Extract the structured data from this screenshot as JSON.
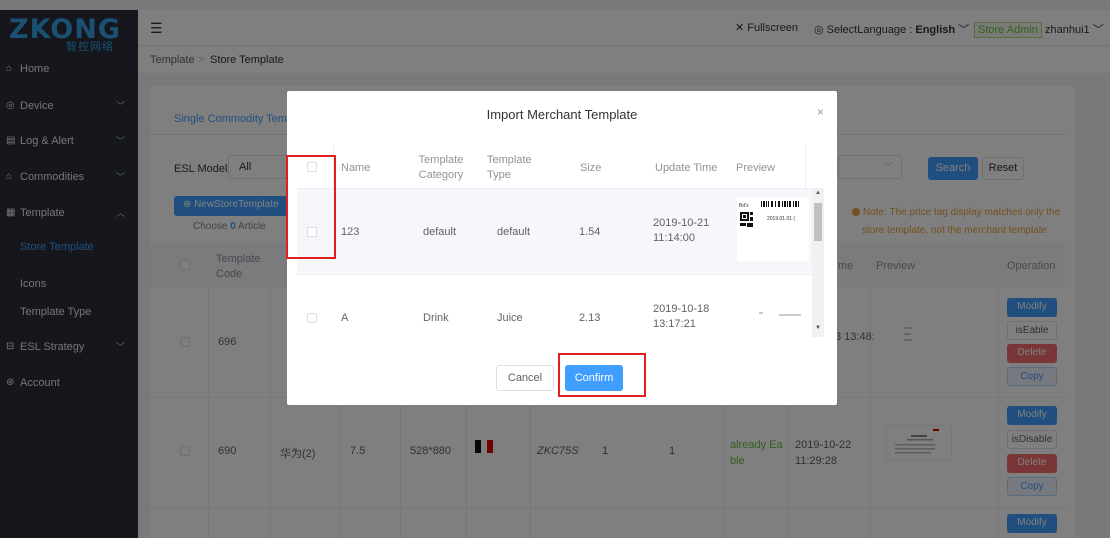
{
  "app": {
    "brand": "ZKONG",
    "brand_cn": "智控网络"
  },
  "header": {
    "fullscreen": "Fullscreen",
    "select_language_prefix": "SelectLanguage :",
    "language": "English",
    "role": "Store Admin",
    "user": "zhanhui1"
  },
  "breadcrumb": {
    "root": "Template",
    "separator": ">",
    "current": "Store Template"
  },
  "sidebar": {
    "items": [
      {
        "label": "Home",
        "icon": "home-icon"
      },
      {
        "label": "Device",
        "icon": "device-icon"
      },
      {
        "label": "Log & Alert",
        "icon": "log-icon"
      },
      {
        "label": "Commodities",
        "icon": "commodities-icon"
      },
      {
        "label": "Template",
        "icon": "template-icon"
      }
    ],
    "sub_items": [
      "Store Template",
      "Icons",
      "Template Type"
    ],
    "after_items": [
      {
        "label": "ESL Strategy",
        "icon": "strategy-icon"
      },
      {
        "label": "Account",
        "icon": "account-icon"
      }
    ]
  },
  "page": {
    "tab_single": "Single Commodity Templa",
    "esl_model_label": "ESL Model",
    "esl_model_value": "All",
    "search_btn": "Search",
    "reset_btn": "Reset",
    "new_store_btn": "NewStoreTemplate",
    "choose_prefix": "Choose",
    "choose_count": "0",
    "choose_suffix": "Article",
    "note_line1": "Note: The price tag display matches only the",
    "note_line2": "store template, not the merchant template",
    "columns": {
      "template_code": "Template Code",
      "time": "me",
      "preview": "Preview",
      "operation": "Operation"
    },
    "rows": [
      {
        "code": "696",
        "time": "3 13:48:",
        "ops": [
          "Modify",
          "isEable",
          "Delete",
          "Copy"
        ]
      },
      {
        "code": "690",
        "name": "华为(2)",
        "size": "7.5",
        "resolution": "528*880",
        "model": "ZKC75S",
        "n1": "1",
        "n2": "1",
        "status": "already Ea ble",
        "time": "2019-10-22 11:29:28",
        "ops": [
          "Modify",
          "isDisable",
          "Delete",
          "Copy"
        ]
      },
      {
        "ops": [
          "Modify"
        ]
      }
    ]
  },
  "modal": {
    "title": "Import Merchant Template",
    "close": "×",
    "columns": {
      "name": "Name",
      "category": "Template Category",
      "type": "Template Type",
      "size": "Size",
      "update_time": "Update Time",
      "preview": "Preview"
    },
    "rows": [
      {
        "name": "123",
        "category": "default",
        "type": "default",
        "size": "1.54",
        "update_time": "2019-10-21 11:14:00"
      },
      {
        "name": "A",
        "category": "Drink",
        "type": "Juice",
        "size": "2.13",
        "update_time": "2019-10-18 13:17:21"
      }
    ],
    "preview_label_date": "2019.01.01 (",
    "cancel": "Cancel",
    "confirm": "Confirm"
  },
  "colors": {
    "primary": "#409eff",
    "sidebar_bg": "#2b2f3a",
    "danger": "#f56c6c",
    "warning": "#e6a23c",
    "highlight": "#e02020"
  }
}
